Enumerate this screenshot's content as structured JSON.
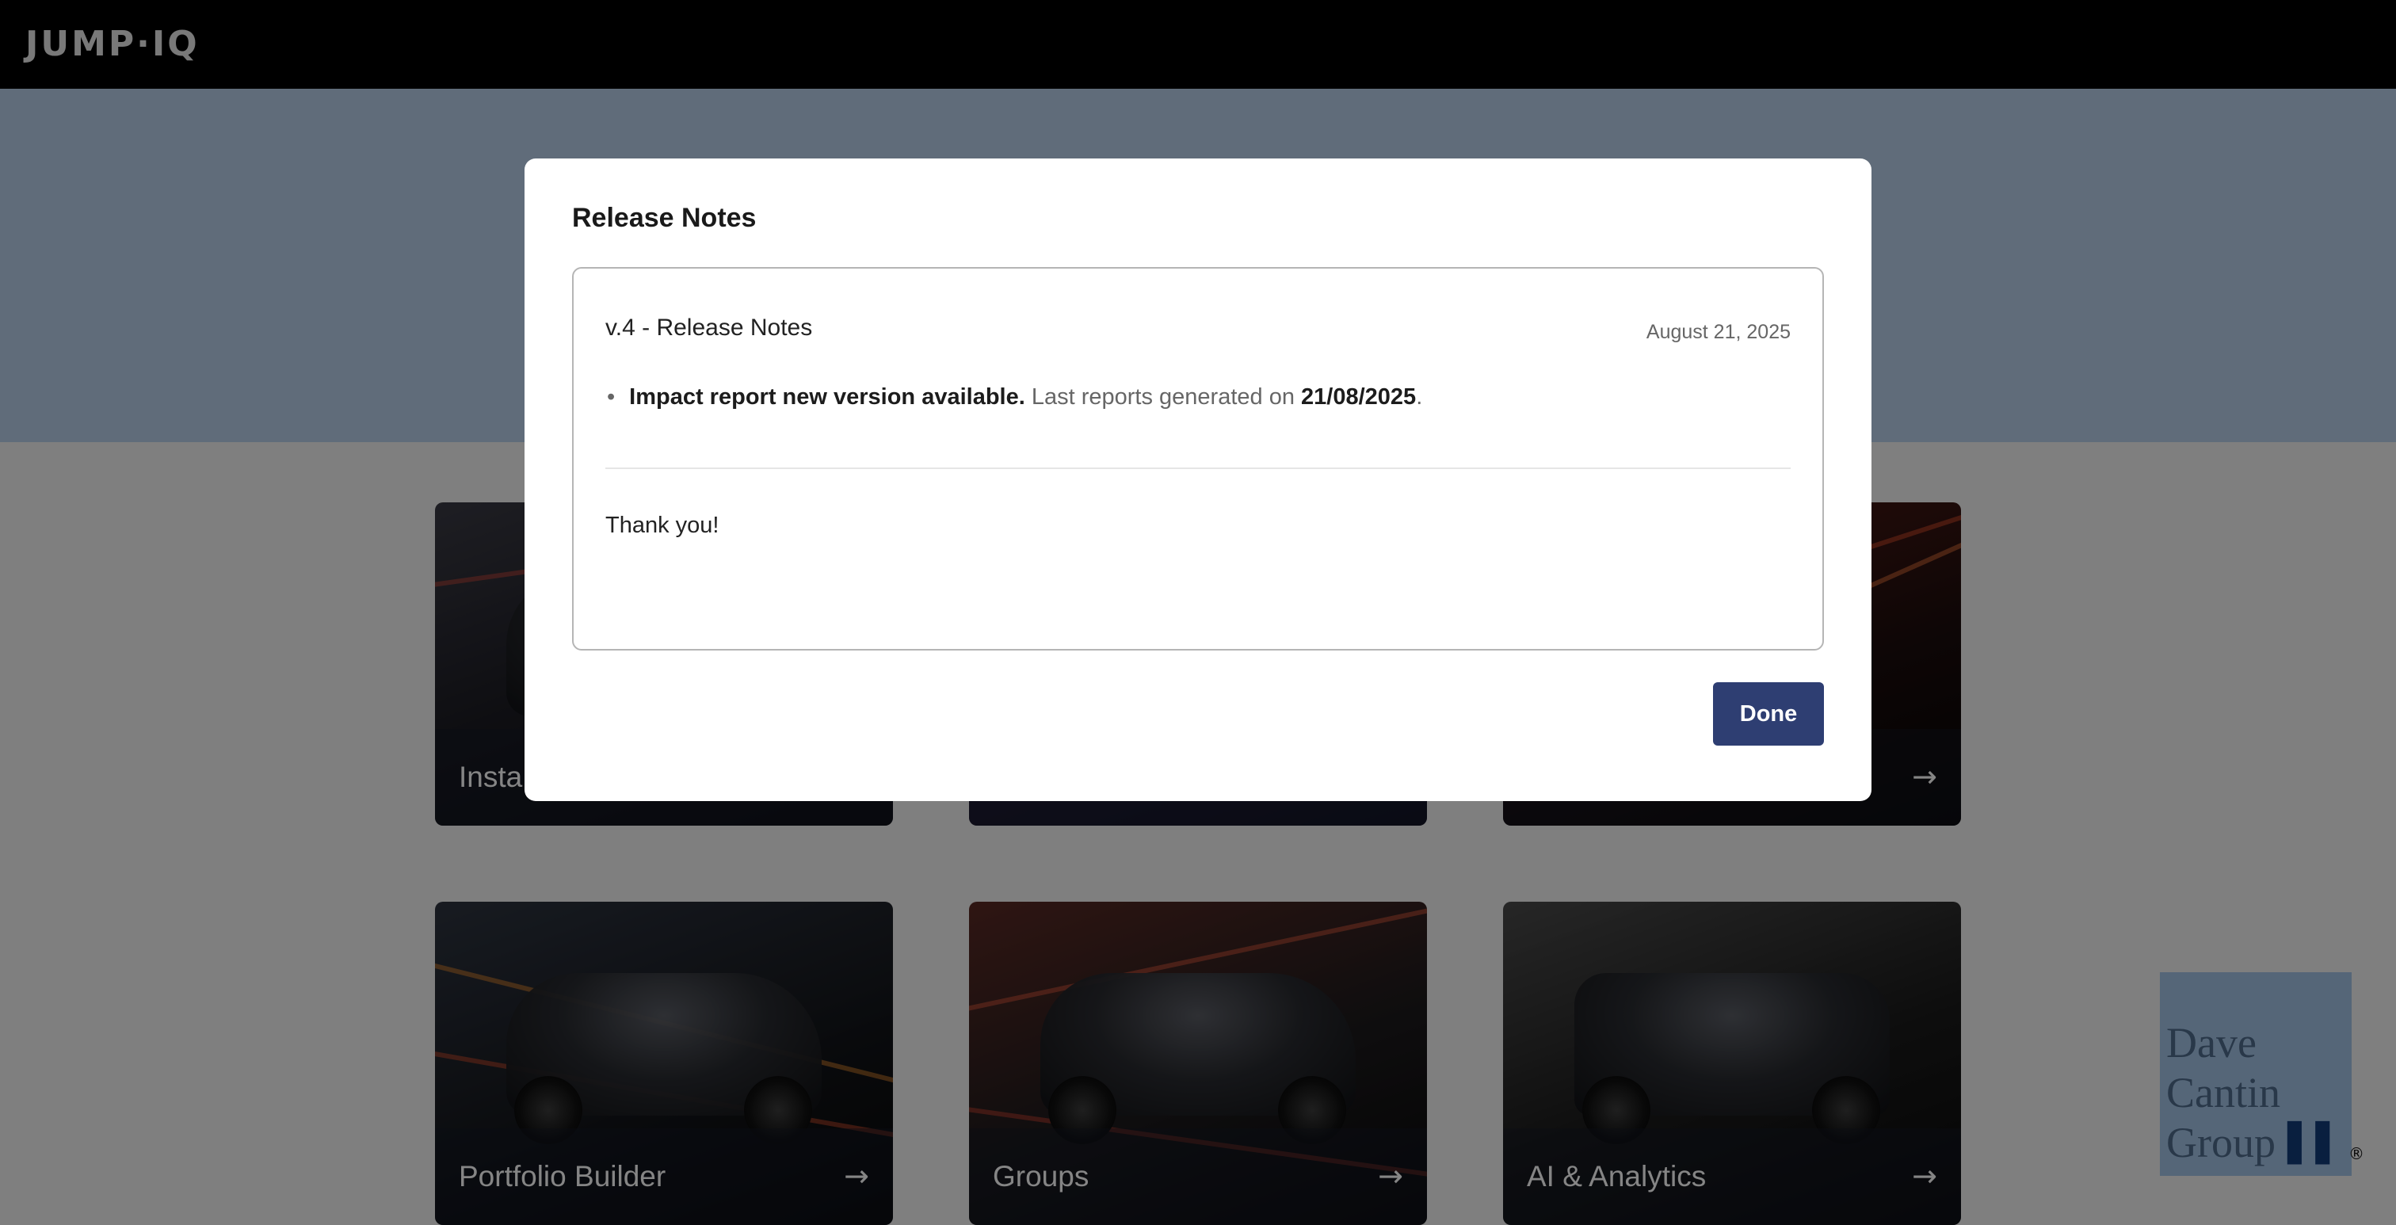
{
  "app": {
    "logo": "JUMP·IQ"
  },
  "tiles": [
    {
      "label": "Insta",
      "arrow": "→"
    },
    {
      "label": "",
      "arrow": "→"
    },
    {
      "label": "",
      "arrow": "→"
    },
    {
      "label": "Portfolio Builder",
      "arrow": "→"
    },
    {
      "label": "Groups",
      "arrow": "→"
    },
    {
      "label": "AI & Analytics",
      "arrow": "→"
    }
  ],
  "branding": {
    "lines": [
      "Dave",
      "Cantin",
      "Group"
    ],
    "mark": "▌▌",
    "reg": "®"
  },
  "modal": {
    "title": "Release Notes",
    "version": "v.4 - Release Notes",
    "date": "August 21, 2025",
    "bullet": {
      "dot": "•",
      "bold": "Impact report new version available.",
      "text": " Last reports generated on ",
      "date_bold": "21/08/2025",
      "end": "."
    },
    "thanks": "Thank you!",
    "done_label": "Done"
  },
  "colors": {
    "topbar": "#000000",
    "hero": "#b9d0ea",
    "done_button": "#2e3e72",
    "overlay": "rgba(0,0,0,0.48)"
  }
}
